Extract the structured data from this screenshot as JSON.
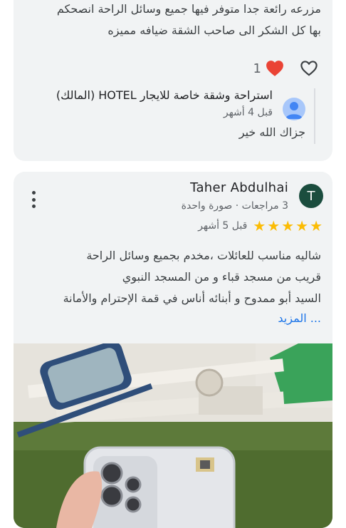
{
  "review1": {
    "text_lines": [
      "مزرعه رائعة جدا متوفر فيها جميع وسائل الراحة انصحكم",
      "بها كل الشكر الى صاحب الشقة ضيافه مميزه"
    ],
    "reactions": {
      "count": "1"
    },
    "owner_reply": {
      "name": "استراحة وشقة خاصة للايجار HOTEL (المالك)",
      "time": "قبل 4 أشهر",
      "text": "جزاك الله خير"
    }
  },
  "review2": {
    "reviewer": {
      "initial": "T",
      "name": "Taher Abdulhai",
      "meta": "3 مراجعات · صورة واحدة"
    },
    "rating": 5,
    "time": "قبل 5 أشهر",
    "text_lines": [
      "شاليه مناسب للعائلات ،مخدم بجميع وسائل الراحة",
      "قريب من مسجد قباء و من المسجد النبوي",
      "السيد أبو ممدوح و أبنائه أناس في قمة الإحترام والأمانة"
    ],
    "more": "... المزيد"
  },
  "colors": {
    "card_bg": "#f1f3f4",
    "star": "#fbbc04",
    "link": "#1a73e8",
    "heart": "#ea4335",
    "reviewer_avatar": "#1b4d3e",
    "owner_avatar": "#a8c7fa"
  },
  "icons": [
    "heart-filled-icon",
    "heart-outline-icon",
    "person-icon",
    "more-vert-icon",
    "star-icon"
  ]
}
